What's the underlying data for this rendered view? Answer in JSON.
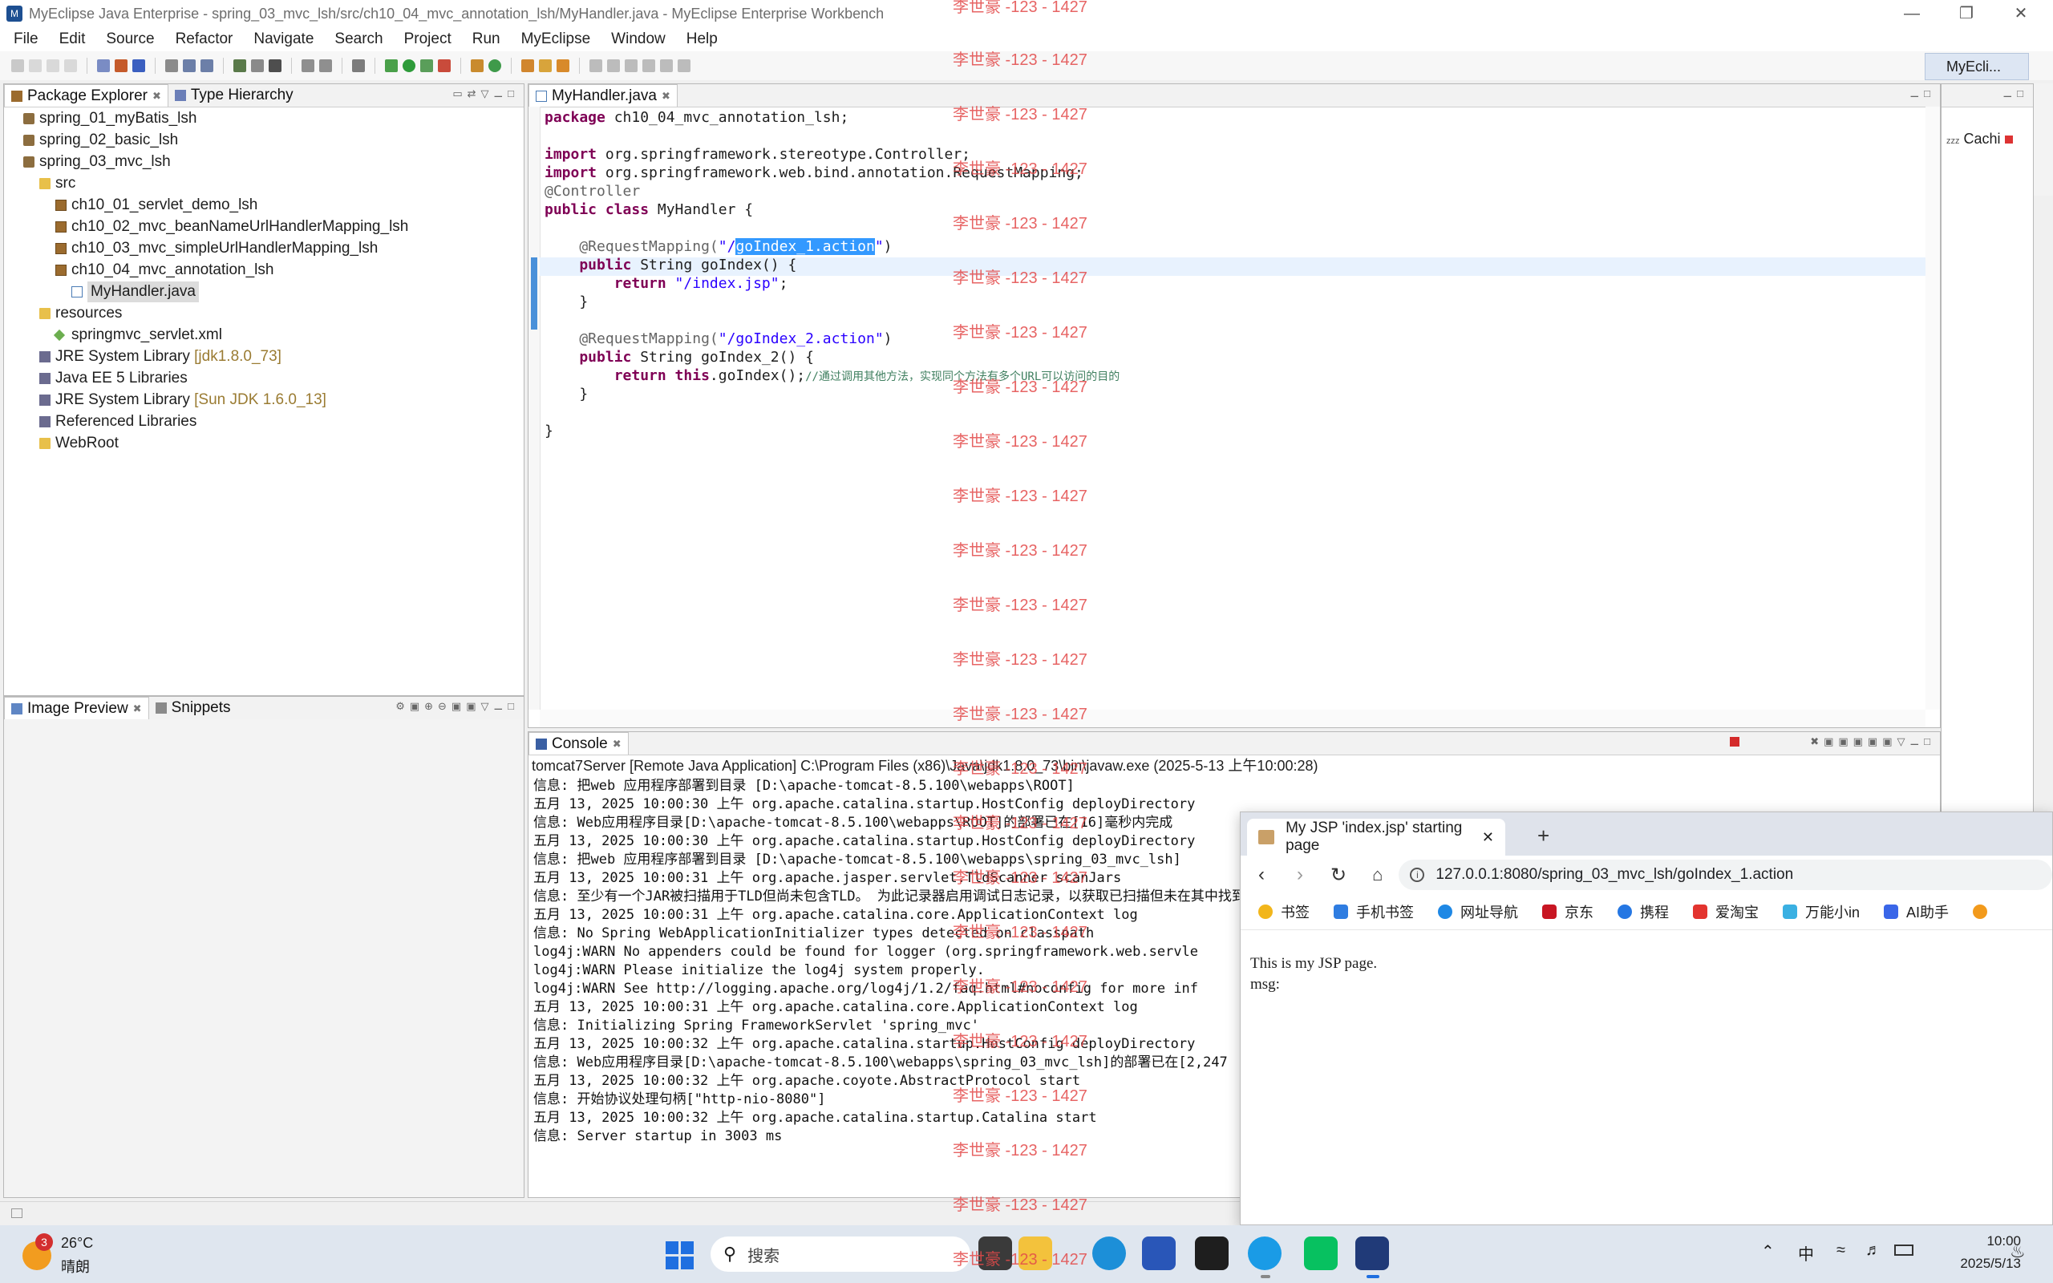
{
  "window": {
    "title": "MyEclipse Java Enterprise - spring_03_mvc_lsh/src/ch10_04_mvc_annotation_lsh/MyHandler.java - MyEclipse Enterprise Workbench"
  },
  "menu": [
    "File",
    "Edit",
    "Source",
    "Refactor",
    "Navigate",
    "Search",
    "Project",
    "Run",
    "MyEclipse",
    "Window",
    "Help"
  ],
  "perspective": {
    "label": "MyEcli..."
  },
  "package_explorer": {
    "tabs": [
      "Package Explorer",
      "Type Hierarchy"
    ],
    "tree": [
      {
        "label": "spring_01_myBatis_lsh",
        "icon": "project-icon"
      },
      {
        "label": "spring_02_basic_lsh",
        "icon": "project-icon"
      },
      {
        "label": "spring_03_mvc_lsh",
        "icon": "project-icon"
      },
      {
        "label": "src",
        "icon": "source-folder-icon"
      },
      {
        "label": "ch10_01_servlet_demo_lsh",
        "icon": "package-icon"
      },
      {
        "label": "ch10_02_mvc_beanNameUrlHandlerMapping_lsh",
        "icon": "package-icon"
      },
      {
        "label": "ch10_03_mvc_simpleUrlHandlerMapping_lsh",
        "icon": "package-icon"
      },
      {
        "label": "ch10_04_mvc_annotation_lsh",
        "icon": "package-icon"
      },
      {
        "label": "MyHandler.java",
        "icon": "java-file-icon"
      },
      {
        "label": "resources",
        "icon": "folder-icon"
      },
      {
        "label": "springmvc_servlet.xml",
        "icon": "xml-file-icon"
      },
      {
        "label": "JRE System Library",
        "suffix": "[jdk1.8.0_73]",
        "icon": "library-icon"
      },
      {
        "label": "Java EE 5 Libraries",
        "icon": "library-icon"
      },
      {
        "label": "JRE System Library",
        "suffix": "[Sun JDK 1.6.0_13]",
        "icon": "library-icon"
      },
      {
        "label": "Referenced Libraries",
        "icon": "library-icon"
      },
      {
        "label": "WebRoot",
        "icon": "folder-icon"
      }
    ]
  },
  "bottom_left": {
    "tabs": [
      "Image Preview",
      "Snippets"
    ]
  },
  "editor": {
    "tab": "MyHandler.java",
    "lines": {
      "l1_kw": "package",
      "l1_rest": " ch10_04_mvc_annotation_lsh;",
      "l3_kw": "import",
      "l3_rest": " org.springframework.stereotype.Controller;",
      "l4_kw": "import",
      "l4_rest": " org.springframework.web.bind.annotation.RequestMapping;",
      "l5": "@Controller",
      "l6_kw": "public class",
      "l6_rest": " MyHandler {",
      "l8_an": "    @RequestMapping(",
      "l8_st1": "\"/",
      "l8_sel": "goIndex_1.action",
      "l8_st2": "\"",
      "l8_end": ")",
      "l9_kw": "    public",
      "l9_rest": " String goIndex() {",
      "l10_kw": "        return",
      "l10_st": " \"/index.jsp\"",
      "l10_end": ";",
      "l11": "    }",
      "l13_an": "    @RequestMapping(",
      "l13_st": "\"/goIndex_2.action\"",
      "l13_end": ")",
      "l14_kw": "    public",
      "l14_rest": " String goIndex_2() {",
      "l15_kw": "        return",
      "l15_kw2": " this",
      "l15_rest": ".goIndex();",
      "l15_cm": "//通过调用其他方法，实现同个方法有多个URL可以访问的目的",
      "l16": "    }",
      "l18": "}"
    }
  },
  "console": {
    "tab": "Console",
    "header": "tomcat7Server [Remote Java Application] C:\\Program Files (x86)\\Java\\jdk1.8.0_73\\bin\\javaw.exe (2025-5-13 上午10:00:28)",
    "lines": [
      "信息: 把web 应用程序部署到目录 [D:\\apache-tomcat-8.5.100\\webapps\\ROOT]",
      "五月 13, 2025 10:00:30 上午 org.apache.catalina.startup.HostConfig deployDirectory",
      "信息: Web应用程序目录[D:\\apache-tomcat-8.5.100\\webapps\\ROOT]的部署已在[16]毫秒内完成",
      "五月 13, 2025 10:00:30 上午 org.apache.catalina.startup.HostConfig deployDirectory",
      "信息: 把web 应用程序部署到目录 [D:\\apache-tomcat-8.5.100\\webapps\\spring_03_mvc_lsh]",
      "五月 13, 2025 10:00:31 上午 org.apache.jasper.servlet.TldScanner scanJars",
      "信息: 至少有一个JAR被扫描用于TLD但尚未包含TLD。 为此记录器启用调试日志记录，以获取已扫描但未在其中找到TLD的完整J",
      "五月 13, 2025 10:00:31 上午 org.apache.catalina.core.ApplicationContext log",
      "信息: No Spring WebApplicationInitializer types detected on classpath",
      "log4j:WARN No appenders could be found for logger (org.springframework.web.servle",
      "log4j:WARN Please initialize the log4j system properly.",
      "log4j:WARN See http://logging.apache.org/log4j/1.2/faq.html#noconfig for more inf",
      "五月 13, 2025 10:00:31 上午 org.apache.catalina.core.ApplicationContext log",
      "信息: Initializing Spring FrameworkServlet 'spring_mvc'",
      "五月 13, 2025 10:00:32 上午 org.apache.catalina.startup.HostConfig deployDirectory",
      "信息: Web应用程序目录[D:\\apache-tomcat-8.5.100\\webapps\\spring_03_mvc_lsh]的部署已在[2,247",
      "五月 13, 2025 10:00:32 上午 org.apache.coyote.AbstractProtocol start",
      "信息: 开始协议处理句柄[\"http-nio-8080\"]",
      "五月 13, 2025 10:00:32 上午 org.apache.catalina.startup.Catalina start",
      "信息: Server startup in 3003 ms"
    ]
  },
  "right_panel": {
    "item": "Cachi"
  },
  "browser": {
    "tab_title": "My JSP 'index.jsp' starting page",
    "url": "127.0.0.1:8080/spring_03_mvc_lsh/goIndex_1.action",
    "bookmarks": [
      "书签",
      "手机书签",
      "网址导航",
      "京东",
      "携程",
      "爱淘宝",
      "万能小in",
      "AI助手"
    ],
    "content": [
      "This is my JSP page.",
      "msg:"
    ]
  },
  "taskbar": {
    "weather_temp": "26°C",
    "weather_desc": "晴朗",
    "weather_badge": "3",
    "search_placeholder": "搜索",
    "ime": "中",
    "time": "10:00",
    "date": "2025/5/13"
  },
  "watermark": "李世豪 -123 - 1427"
}
